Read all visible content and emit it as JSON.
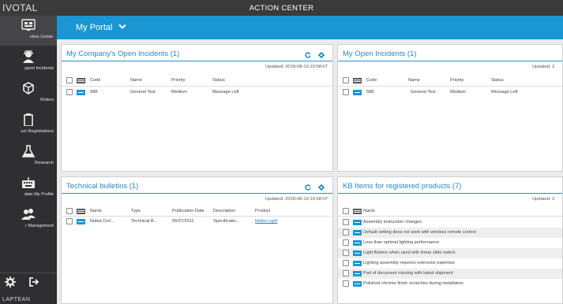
{
  "brand": "IVOTAL",
  "app_title": "ACTION CENTER",
  "sidebar": {
    "items": [
      {
        "label": "ction Center",
        "icon": "dashboard-icon"
      },
      {
        "label": "pport Incidents",
        "icon": "support-agent-icon"
      },
      {
        "label": "Orders",
        "icon": "orders-icon"
      },
      {
        "label": "uct Registrations",
        "icon": "clipboard-icon"
      },
      {
        "label": "Research",
        "icon": "flask-icon"
      },
      {
        "label": "date My Profile",
        "icon": "keyboard-icon"
      },
      {
        "label": "r Management",
        "icon": "users-icon"
      }
    ],
    "footer_brand": "LAPTEAN",
    "footer_icons": [
      "gear-icon",
      "logout-icon"
    ]
  },
  "portal": {
    "title": "My Portal",
    "chevron": "chevron-down-icon"
  },
  "panels": {
    "company_incidents": {
      "title": "My Company's Open Incidents (1)",
      "updated": "Updated: 2018-08-19 10:58:07",
      "columns": [
        "Code",
        "Name",
        "Priority",
        "Status"
      ],
      "rows": [
        {
          "code": "588",
          "name": "General Test",
          "priority": "Medium",
          "status": "Message Left"
        }
      ]
    },
    "my_incidents": {
      "title": "My Open Incidents (1)",
      "updated": "Updated: 2",
      "columns": [
        "Code",
        "Name",
        "Priority",
        "Status"
      ],
      "rows": [
        {
          "code": "588",
          "name": "General Test",
          "priority": "Medium",
          "status": "Message Left"
        }
      ]
    },
    "bulletins": {
      "title": "Technical bulletins (1)",
      "updated": "Updated: 2018-08-19 10:58:07",
      "columns": [
        "Name",
        "Type",
        "Publication Date",
        "Description",
        "Product"
      ],
      "rows": [
        {
          "name": "Nubia Ceil...",
          "type": "Technical B...",
          "date": "05/07/2011",
          "description": "Specificatio...",
          "product": "Nubia Light"
        }
      ]
    },
    "kb": {
      "title": "KB Items for registered products (7)",
      "updated": "Updated: 2",
      "columns": [
        "Name"
      ],
      "rows": [
        "Assembly instruction changes",
        "Default setting does not work with wireless remote control",
        "Less than optimal lighting performance",
        "Light flickers when used with linear slide switch",
        "Lighting assembly requires extensive expertise",
        "Part of document missing with latest shipment",
        "Polished chrome finish scratches during installation"
      ]
    }
  },
  "colors": {
    "accent": "#1a96d3",
    "sidebar": "#2f2f31",
    "topbar": "#3a3a3a",
    "link": "#1a7fc4"
  }
}
